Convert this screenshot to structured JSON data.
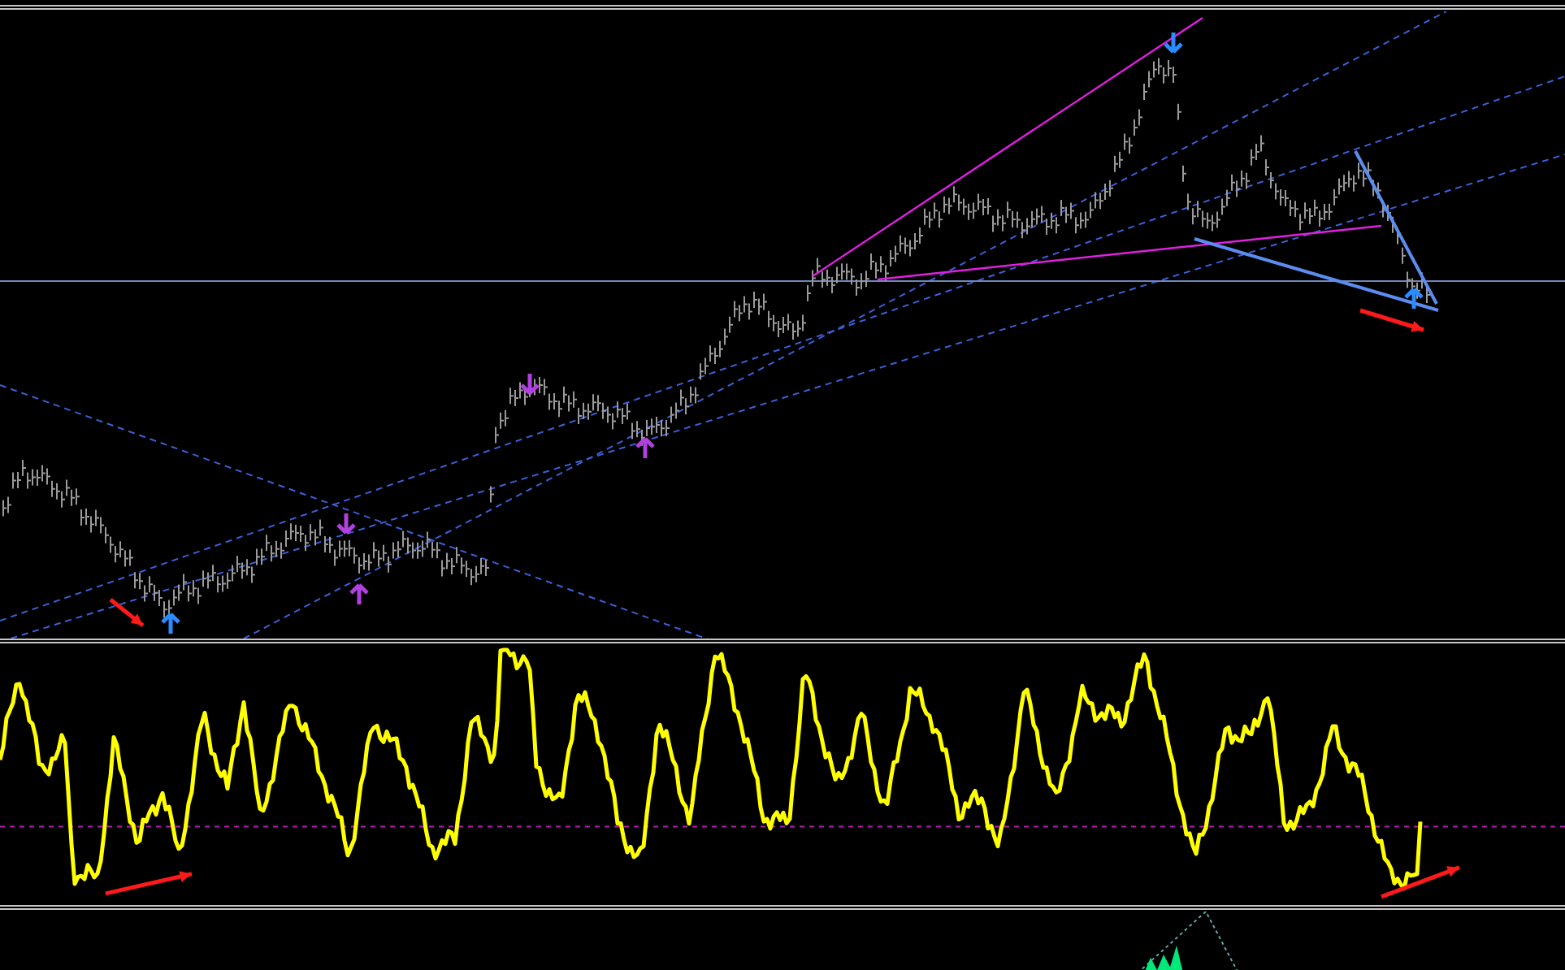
{
  "panes": [
    {
      "kind": "price"
    },
    {
      "kind": "oscillator"
    },
    {
      "kind": "histogram"
    }
  ]
}
